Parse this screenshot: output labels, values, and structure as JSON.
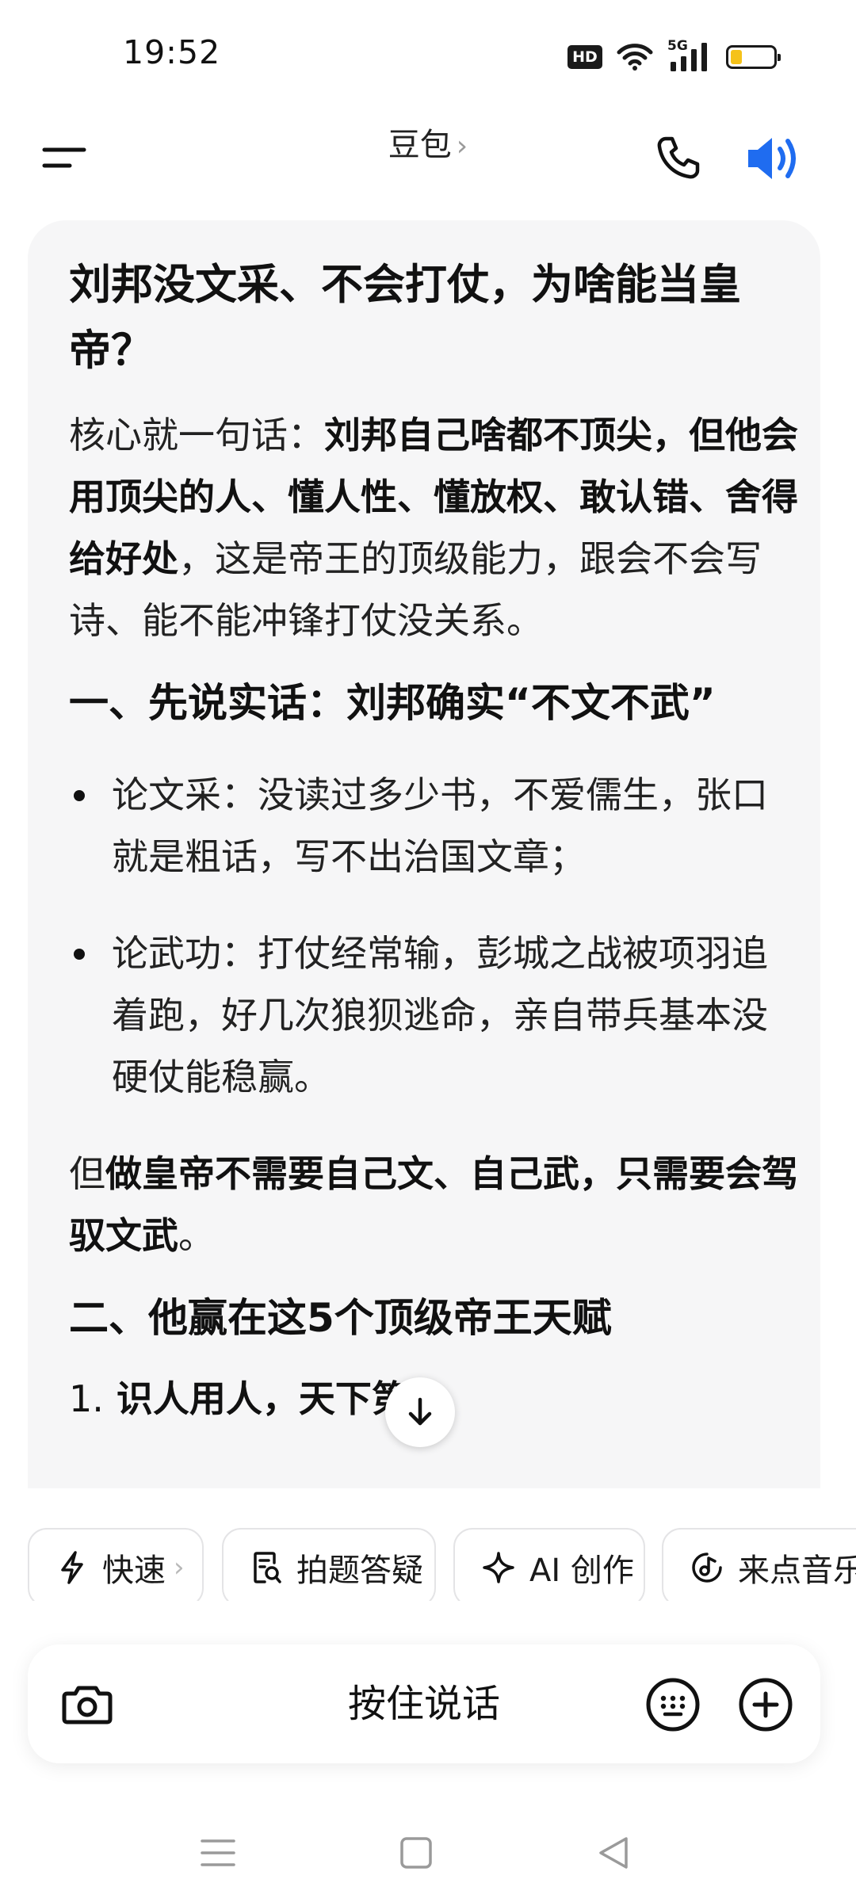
{
  "status_bar": {
    "time": "19:52",
    "network": "5G",
    "hd_badge": "HD",
    "battery_level": 0.35,
    "battery_color": "#f5c21a"
  },
  "header": {
    "title": "豆包",
    "title_chevron": "›",
    "icons": {
      "menu": "menu-icon",
      "phone": "phone-icon",
      "speaker": "speaker-icon"
    },
    "accent_color": "#1f6cf0"
  },
  "message": {
    "title": "刘邦没文采、不会打仗，为啥能当皇帝？",
    "intro": {
      "prefix": "核心就一句话：",
      "bold": "刘邦自己啥都不顶尖，但他会用顶尖的人、懂人性、懂放权、敢认错、舍得给好处",
      "suffix": "，这是帝王的顶级能力，跟会不会写诗、能不能冲锋打仗没关系。"
    },
    "section1_heading": "一、先说实话：刘邦确实“不文不武”",
    "bullets": [
      "论文采：没读过多少书，不爱儒生，张口就是粗话，写不出治国文章；",
      "论武功：打仗经常输，彭城之战被项羽追着跑，好几次狼狈逃命，亲自带兵基本没硬仗能稳赢。"
    ],
    "conclusion": {
      "prefix": "但",
      "bold": "做皇帝不需要自己文、自己武，只需要会驾驭文武",
      "suffix": "。"
    },
    "section2_heading": "二、他赢在这5个顶级帝王天赋",
    "subheading_num": "1.",
    "subheading_text": "识人用人，天下第一"
  },
  "scroll_down": {
    "icon": "arrow-down-icon"
  },
  "quick_actions": [
    {
      "label": "快速",
      "icon": "lightning-icon",
      "chevron": "›"
    },
    {
      "label": "拍题答疑",
      "icon": "question-scan-icon"
    },
    {
      "label": "AI 创作",
      "icon": "sparkle-icon"
    },
    {
      "label": "来点音乐",
      "icon": "music-note-icon"
    }
  ],
  "input_bar": {
    "hold_to_talk": "按住说话",
    "icons": {
      "camera": "camera-icon",
      "keyboard": "keyboard-icon",
      "add": "plus-icon"
    }
  },
  "nav_bar": {
    "icons": [
      "nav-menu-icon",
      "nav-home-icon",
      "nav-back-icon"
    ]
  }
}
